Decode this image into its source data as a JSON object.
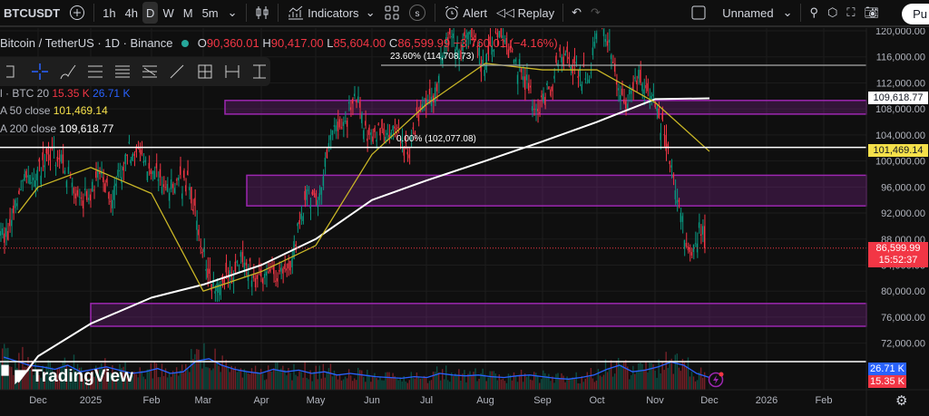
{
  "toolbar": {
    "symbol": "BTCUSDT",
    "intervals": [
      "1h",
      "4h",
      "D",
      "W",
      "M",
      "5m"
    ],
    "selected_interval": "D",
    "indicators": "Indicators",
    "alert": "Alert",
    "replay": "Replay",
    "layout_name": "Unnamed",
    "publish": "Pu"
  },
  "legend": {
    "title": "Bitcoin / TetherUS · 1D · Binance",
    "o_label": "O",
    "o": "90,360.01",
    "h_label": "H",
    "h": "90,417.00",
    "l_label": "L",
    "l": "85,604.00",
    "c_label": "C",
    "c": "86,599.99",
    "change": "−3,760.01 (−4.16%)"
  },
  "indicators": [
    {
      "name": "l · BTC 20",
      "v1": "15.35 K",
      "v2": "26.71 K"
    },
    {
      "name": "A 50 close",
      "v1": "101,469.14"
    },
    {
      "name": "A 200 close",
      "v1": "109,618.77"
    }
  ],
  "fib": [
    {
      "label": "23.60% (114,708.73)",
      "price": 114708.73
    },
    {
      "label": "0.00% (102,077.08)",
      "price": 102077.08
    }
  ],
  "price_labels": {
    "ma200": "109,618.77",
    "ma50": "101,469.14",
    "last": "86,599.99",
    "countdown": "15:52:37",
    "vol_ma": "26.71 K",
    "vol": "15.35 K"
  },
  "colors": {
    "up": "#089981",
    "down": "#f23645",
    "ma50": "#c9b626",
    "ma200": "#ffffff",
    "zone": "#9c27b0",
    "vol_ma": "#2962ff"
  },
  "chart_data": {
    "type": "candlestick",
    "y_ticks": [
      "120,000.00",
      "116,000.00",
      "112,000.00",
      "108,000.00",
      "104,000.00",
      "100,000.00",
      "96,000.00",
      "92,000.00",
      "88,000.00",
      "84,000.00",
      "80,000.00",
      "76,000.00",
      "72,000.00"
    ],
    "x_ticks": [
      "Dec",
      "2025",
      "Feb",
      "Mar",
      "Apr",
      "May",
      "Jun",
      "Jul",
      "Aug",
      "Sep",
      "Oct",
      "Nov",
      "Dec",
      "2026",
      "Feb"
    ],
    "weekly_closes": [
      90000,
      97000,
      97000,
      101000,
      101000,
      95000,
      94000,
      98000,
      94000,
      101000,
      102000,
      98000,
      96000,
      97000,
      96000,
      86000,
      80000,
      82000,
      86000,
      82000,
      83000,
      83000,
      85000,
      94000,
      94000,
      104000,
      106000,
      109000,
      104000,
      105000,
      105000,
      101000,
      108000,
      109000,
      119000,
      117000,
      119000,
      114000,
      119000,
      117000,
      113000,
      108000,
      111000,
      116000,
      115000,
      112000,
      123000,
      115000,
      108000,
      114000,
      110000,
      104000,
      94000,
      86000,
      90000,
      86600
    ],
    "ma50_monthly": [
      92000,
      96000,
      99000,
      95000,
      80000,
      83000,
      87000,
      101000,
      108700,
      115000,
      114000,
      114000,
      109000,
      101469
    ],
    "ma200_monthly": [
      66000,
      70000,
      75000,
      79000,
      81000,
      84000,
      88000,
      94000,
      97000,
      100000,
      103000,
      106000,
      109500,
      109619
    ],
    "weekly_volume": [
      40,
      35,
      30,
      28,
      25,
      30,
      22,
      25,
      28,
      24,
      20,
      22,
      26,
      20,
      22,
      35,
      38,
      30,
      25,
      22,
      20,
      25,
      22,
      24,
      20,
      22,
      18,
      20,
      18,
      16,
      15,
      14,
      16,
      15,
      20,
      18,
      17,
      18,
      16,
      15,
      17,
      18,
      16,
      14,
      13,
      15,
      18,
      25,
      30,
      22,
      24,
      28,
      34,
      30,
      20,
      15
    ],
    "zones": [
      [
        107200,
        109300
      ],
      [
        93100,
        97800
      ],
      [
        74600,
        78100
      ]
    ]
  }
}
